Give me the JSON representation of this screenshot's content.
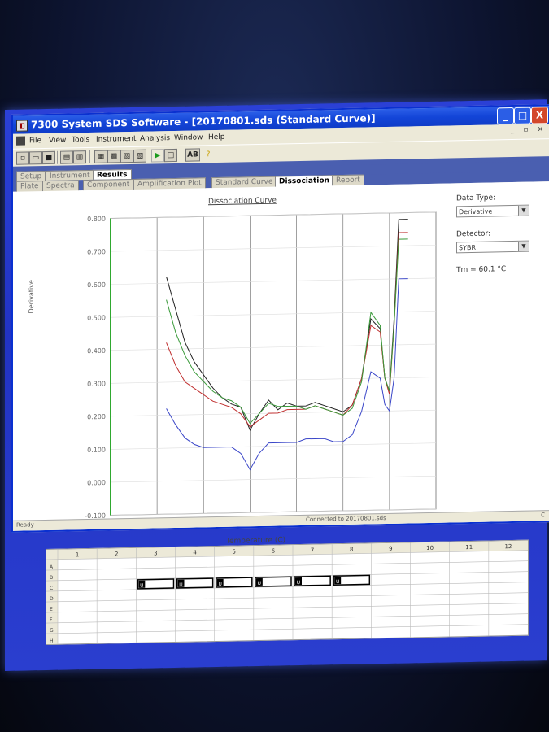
{
  "window": {
    "title": "7300 System SDS Software - [20170801.sds (Standard Curve)]",
    "min_glyph": "_",
    "max_glyph": "□",
    "close_glyph": "X"
  },
  "menu": [
    "File",
    "View",
    "Tools",
    "Instrument",
    "Analysis",
    "Window",
    "Help"
  ],
  "mdi_controls": "_ ▫ ×",
  "toolbar": {
    "ab_label": "AB"
  },
  "tabs_top": [
    {
      "label": "Setup",
      "active": false
    },
    {
      "label": "Instrument",
      "active": false
    },
    {
      "label": "Results",
      "active": true
    }
  ],
  "tabs_sub": [
    {
      "label": "Plate",
      "active": false
    },
    {
      "label": "Spectra",
      "active": false
    },
    {
      "label": "Component",
      "active": false
    },
    {
      "label": "Amplification Plot",
      "active": false
    },
    {
      "label": "Standard Curve",
      "active": false
    },
    {
      "label": "Dissociation",
      "active": true
    },
    {
      "label": "Report",
      "active": false
    }
  ],
  "side_panel": {
    "data_type_label": "Data Type:",
    "data_type_value": "Derivative",
    "detector_label": "Detector:",
    "detector_value": "SYBR",
    "tm_text": "Tm = 60.1 °C"
  },
  "plate": {
    "columns": [
      "1",
      "2",
      "3",
      "4",
      "5",
      "6",
      "7",
      "8",
      "9",
      "10",
      "11",
      "12"
    ],
    "rows": [
      "A",
      "B",
      "C",
      "D",
      "E",
      "F",
      "G",
      "H"
    ],
    "wells_row_c": [
      "U",
      "U",
      "U",
      "U",
      "U",
      "U"
    ]
  },
  "status": {
    "left": "Ready",
    "right": "Connected to 20170801.sds",
    "corner": "C"
  },
  "chart_data": {
    "type": "line",
    "title": "Dissociation Curve",
    "xlabel": "Temperature (C)",
    "ylabel": "Derivative",
    "xlim": [
      60,
      95
    ],
    "ylim": [
      -0.1,
      0.8
    ],
    "xticks": [
      60,
      65,
      70,
      75,
      80,
      85,
      90,
      95
    ],
    "yticks": [
      "0.800",
      "0.700",
      "0.600",
      "0.500",
      "0.400",
      "0.300",
      "0.200",
      "0.100",
      "0.000",
      "-0.100"
    ],
    "grid": true,
    "series": [
      {
        "color": "#222222",
        "x": [
          66,
          67,
          68,
          69,
          70,
          71,
          72,
          73,
          74,
          75,
          76,
          77,
          78,
          79,
          80,
          81,
          82,
          83,
          84,
          85,
          86,
          87,
          88,
          89,
          89.5,
          90,
          90.5,
          91,
          92
        ],
        "y": [
          0.62,
          0.52,
          0.42,
          0.36,
          0.32,
          0.28,
          0.25,
          0.23,
          0.22,
          0.15,
          0.2,
          0.24,
          0.21,
          0.23,
          0.22,
          0.22,
          0.23,
          0.22,
          0.21,
          0.2,
          0.22,
          0.3,
          0.48,
          0.45,
          0.3,
          0.26,
          0.48,
          0.78,
          0.78
        ]
      },
      {
        "color": "#c03030",
        "x": [
          66,
          67,
          68,
          69,
          70,
          71,
          72,
          73,
          74,
          75,
          76,
          77,
          78,
          79,
          80,
          81,
          82,
          83,
          84,
          85,
          86,
          87,
          88,
          89,
          89.5,
          90,
          90.5,
          91,
          92
        ],
        "y": [
          0.42,
          0.35,
          0.3,
          0.28,
          0.26,
          0.24,
          0.23,
          0.22,
          0.2,
          0.16,
          0.18,
          0.2,
          0.2,
          0.21,
          0.21,
          0.21,
          0.22,
          0.21,
          0.2,
          0.19,
          0.22,
          0.3,
          0.46,
          0.44,
          0.3,
          0.25,
          0.46,
          0.74,
          0.74
        ]
      },
      {
        "color": "#3a9a3a",
        "x": [
          66,
          67,
          68,
          69,
          70,
          71,
          72,
          73,
          74,
          75,
          76,
          77,
          78,
          79,
          80,
          81,
          82,
          83,
          84,
          85,
          86,
          87,
          88,
          89,
          89.5,
          90,
          90.5,
          91,
          92
        ],
        "y": [
          0.55,
          0.45,
          0.38,
          0.33,
          0.3,
          0.27,
          0.25,
          0.24,
          0.22,
          0.17,
          0.2,
          0.23,
          0.22,
          0.22,
          0.22,
          0.21,
          0.22,
          0.21,
          0.2,
          0.19,
          0.21,
          0.29,
          0.5,
          0.46,
          0.3,
          0.26,
          0.46,
          0.72,
          0.72
        ]
      },
      {
        "color": "#3a46c8",
        "x": [
          66,
          67,
          68,
          69,
          70,
          71,
          72,
          73,
          74,
          75,
          76,
          77,
          78,
          79,
          80,
          81,
          82,
          83,
          84,
          85,
          86,
          87,
          88,
          89,
          89.5,
          90,
          90.5,
          91,
          92
        ],
        "y": [
          0.22,
          0.17,
          0.13,
          0.11,
          0.1,
          0.1,
          0.1,
          0.1,
          0.08,
          0.03,
          0.08,
          0.11,
          0.11,
          0.11,
          0.11,
          0.12,
          0.12,
          0.12,
          0.11,
          0.11,
          0.13,
          0.2,
          0.32,
          0.3,
          0.22,
          0.2,
          0.3,
          0.6,
          0.6
        ]
      }
    ]
  }
}
